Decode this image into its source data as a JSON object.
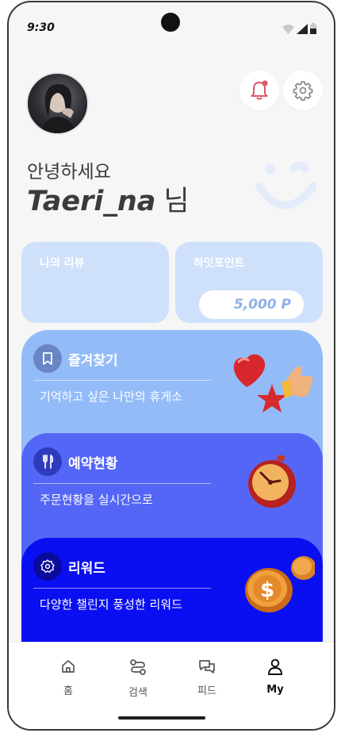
{
  "status_bar": {
    "time": "9:30"
  },
  "profile": {
    "greeting": "안녕하세요",
    "username": "Taeri_na",
    "suffix": "님"
  },
  "cards": {
    "review_title": "나의 리뷰",
    "point_title": "하잇포인트",
    "point_value": "5,000 P"
  },
  "panels": [
    {
      "title": "즐겨찾기",
      "description": "기억하고 싶은 나만의 휴게소",
      "icon": "bookmark-icon",
      "color": "#93bbf8"
    },
    {
      "title": "예약현황",
      "description": "주문현황을 실시간으로",
      "icon": "utensils-icon",
      "color": "#5466f5"
    },
    {
      "title": "리워드",
      "description": "다양한 챌린지 풍성한 리워드",
      "icon": "badge-icon",
      "color": "#0a0ff2"
    }
  ],
  "nav": {
    "items": [
      {
        "label": "홈",
        "icon": "home-icon",
        "active": false
      },
      {
        "label": "검색",
        "icon": "route-icon",
        "active": false
      },
      {
        "label": "피드",
        "icon": "chat-icon",
        "active": false
      },
      {
        "label": "My",
        "icon": "user-icon",
        "active": true
      }
    ]
  }
}
